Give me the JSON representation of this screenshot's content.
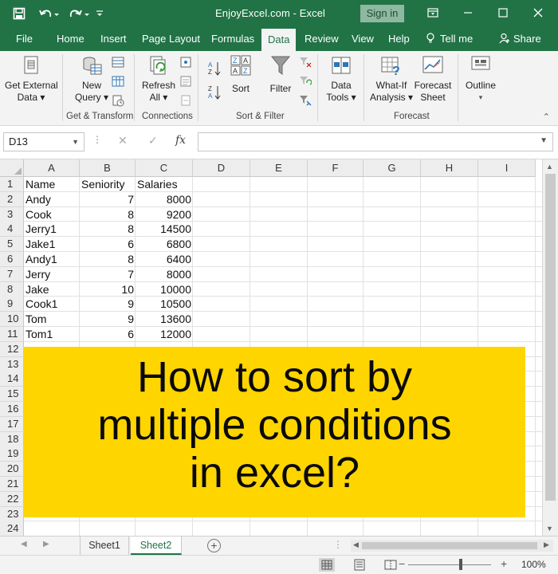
{
  "titlebar": {
    "title": "EnjoyExcel.com  -  Excel",
    "signin": "Sign in"
  },
  "tabs": [
    "File",
    "Home",
    "Insert",
    "Page Layout",
    "Formulas",
    "Data",
    "Review",
    "View",
    "Help",
    "Tell me",
    "Share"
  ],
  "active_tab": "Data",
  "ribbon": {
    "get_external_1": "Get External",
    "get_external_2": "Data ▾",
    "new_query_1": "New",
    "new_query_2": "Query ▾",
    "refresh_1": "Refresh",
    "refresh_2": "All ▾",
    "sort": "Sort",
    "filter": "Filter",
    "data_tools_1": "Data",
    "data_tools_2": "Tools ▾",
    "whatif_1": "What-If",
    "whatif_2": "Analysis ▾",
    "forecast_1": "Forecast",
    "forecast_2": "Sheet",
    "outline": "Outline",
    "groups": {
      "get_transform": "Get & Transform",
      "connections": "Connections",
      "sort_filter": "Sort & Filter",
      "forecast": "Forecast"
    }
  },
  "formula_bar": {
    "name_box": "D13",
    "fx": "fx",
    "value": ""
  },
  "columns": [
    "A",
    "B",
    "C",
    "D",
    "E",
    "F",
    "G",
    "H",
    "I"
  ],
  "rows": [
    "1",
    "2",
    "3",
    "4",
    "5",
    "6",
    "7",
    "8",
    "9",
    "10",
    "11",
    "12",
    "13",
    "14",
    "15",
    "16",
    "17",
    "18",
    "19",
    "20",
    "21",
    "22",
    "23",
    "24"
  ],
  "table": {
    "headers": [
      "Name",
      "Seniority",
      "Salaries"
    ],
    "rows": [
      [
        "Andy",
        "7",
        "8000"
      ],
      [
        "Cook",
        "8",
        "9200"
      ],
      [
        "Jerry1",
        "8",
        "14500"
      ],
      [
        "Jake1",
        "6",
        "6800"
      ],
      [
        "Andy1",
        "8",
        "6400"
      ],
      [
        "Jerry",
        "7",
        "8000"
      ],
      [
        "Jake",
        "10",
        "10000"
      ],
      [
        "Cook1",
        "9",
        "10500"
      ],
      [
        "Tom",
        "9",
        "13600"
      ],
      [
        "Tom1",
        "6",
        "12000"
      ]
    ]
  },
  "banner": {
    "line1": "How to sort by",
    "line2": "multiple conditions",
    "line3": "in excel?"
  },
  "sheets": [
    "Sheet1",
    "Sheet2"
  ],
  "active_sheet": "Sheet2",
  "status": {
    "zoom": "100%",
    "zoom_fraction": 0.5
  },
  "colors": {
    "excel_green": "#217346",
    "banner_yellow": "#ffd500"
  }
}
